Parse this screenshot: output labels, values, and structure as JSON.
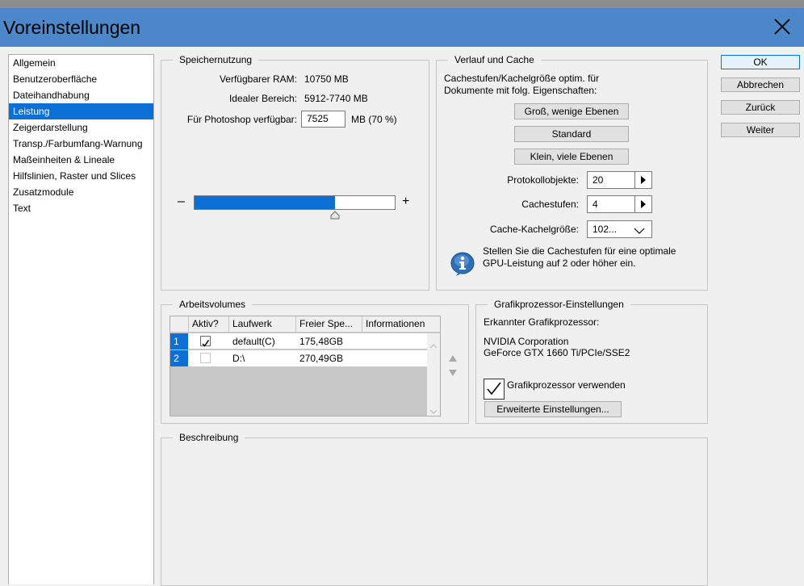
{
  "window": {
    "title": "Voreinstellungen",
    "close_icon": "close-icon"
  },
  "nav": {
    "items": [
      {
        "label": "Allgemein"
      },
      {
        "label": "Benutzeroberfläche"
      },
      {
        "label": "Dateihandhabung"
      },
      {
        "label": "Leistung",
        "active": true
      },
      {
        "label": "Zeigerdarstellung"
      },
      {
        "label": "Transp./Farbumfang-Warnung"
      },
      {
        "label": "Maßeinheiten & Lineale"
      },
      {
        "label": "Hilfslinien, Raster und Slices"
      },
      {
        "label": "Zusatzmodule"
      },
      {
        "label": "Text"
      }
    ]
  },
  "memory": {
    "legend": "Speichernutzung",
    "available_label": "Verfügbarer RAM:",
    "available_value": "10750 MB",
    "ideal_label": "Idealer Bereich:",
    "ideal_value": "5912-7740 MB",
    "photoshop_label": "Für Photoshop verfügbar:",
    "photoshop_value": "7525",
    "photoshop_unit": "MB (70 %)",
    "minus": "–",
    "plus": "+",
    "slider_percent": 70
  },
  "history": {
    "legend": "Verlauf und Cache",
    "desc_line1": "Cachestufen/Kachelgröße optim. für",
    "desc_line2": "Dokumente mit folg. Eigenschaften:",
    "btn_large": "Groß, wenige Ebenen",
    "btn_default": "Standard",
    "btn_small": "Klein, viele Ebenen",
    "states_label": "Protokollobjekte:",
    "states_value": "20",
    "cache_levels_label": "Cachestufen:",
    "cache_levels_value": "4",
    "tile_size_label": "Cache-Kachelgröße:",
    "tile_size_value": "102...",
    "info_line1": "Stellen Sie die Cachestufen für eine optimale",
    "info_line2": "GPU-Leistung auf 2 oder höher ein."
  },
  "scratch": {
    "legend": "Arbeitsvolumes",
    "columns": [
      "Aktiv?",
      "Laufwerk",
      "Freier Spe...",
      "Informationen"
    ],
    "rows": [
      {
        "num": "1",
        "active": true,
        "drive": "default(C)",
        "free": "175,48GB",
        "info": ""
      },
      {
        "num": "2",
        "active": false,
        "drive": "D:\\",
        "free": "270,49GB",
        "info": ""
      }
    ]
  },
  "gpu": {
    "legend": "Grafikprozessor-Einstellungen",
    "detected_label": "Erkannter Grafikprozessor:",
    "vendor": "NVIDIA Corporation",
    "model": "GeForce GTX 1660 Ti/PCIe/SSE2",
    "use_gpu_label": "Grafikprozessor verwenden",
    "use_gpu_checked": true,
    "advanced_button": "Erweiterte Einstellungen..."
  },
  "description": {
    "legend": "Beschreibung"
  },
  "buttons": {
    "ok": "OK",
    "cancel": "Abbrechen",
    "reset": "Zurück",
    "next": "Weiter"
  },
  "colors": {
    "accent": "#0c6fd6",
    "titlebar": "#4c88c9",
    "panel": "#f0f0f0"
  }
}
